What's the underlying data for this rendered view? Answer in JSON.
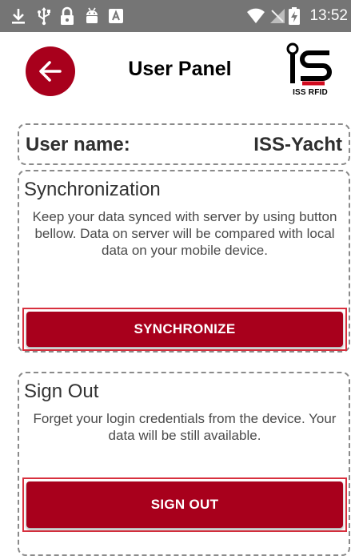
{
  "status_bar": {
    "time": "13:52",
    "icons": [
      "download-icon",
      "usb-icon",
      "lock-icon",
      "android-icon",
      "keyboard-icon",
      "wifi-icon",
      "no-sim-icon",
      "battery-charging-icon"
    ],
    "background": "#757575"
  },
  "header": {
    "title": "User Panel",
    "back_icon": "arrow-left-icon",
    "logo_caption": "ISS RFID",
    "accent_color": "#a8001c"
  },
  "user_card": {
    "label": "User name:",
    "value": "ISS-Yacht"
  },
  "sync_card": {
    "title": "Synchronization",
    "description": "Keep your data synced with server by using button bellow. Data on server will be compared with local data on your mobile device.",
    "button_label": "SYNCHRONIZE"
  },
  "signout_card": {
    "title": "Sign Out",
    "description": "Forget your login credentials from the device. Your data will be still available.",
    "button_label": "SIGN OUT"
  }
}
